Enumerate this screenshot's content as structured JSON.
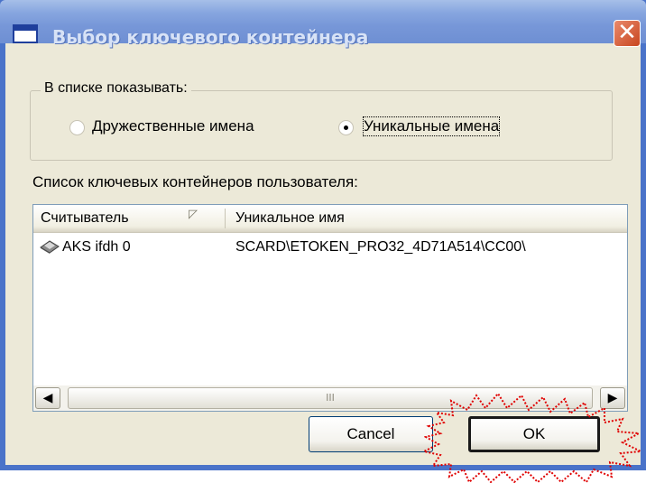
{
  "window": {
    "title": "Выбор ключевого контейнера"
  },
  "display_group": {
    "legend": "В списке показывать:",
    "options": [
      {
        "label": "Дружественные имена",
        "checked": false
      },
      {
        "label": "Уникальные имена",
        "checked": true
      }
    ]
  },
  "list": {
    "caption": "Список ключевых контейнеров пользователя:",
    "columns": [
      "Считыватель",
      "Уникальное имя"
    ],
    "rows": [
      {
        "reader": "AKS ifdh 0",
        "unique_name": "SCARD\\ETOKEN_PRO32_4D71A514\\CC00\\"
      }
    ],
    "scroll_grip": "III"
  },
  "buttons": {
    "cancel": "Cancel",
    "ok": "OK"
  },
  "icons": {
    "title": "window-icon",
    "close": "close-icon",
    "reader": "card-reader-icon",
    "scroll_left": "chevron-left-icon",
    "scroll_right": "chevron-right-icon"
  },
  "colors": {
    "highlight": "#e00000",
    "titlebar": "#7797d8",
    "close_button": "#c8461f"
  }
}
